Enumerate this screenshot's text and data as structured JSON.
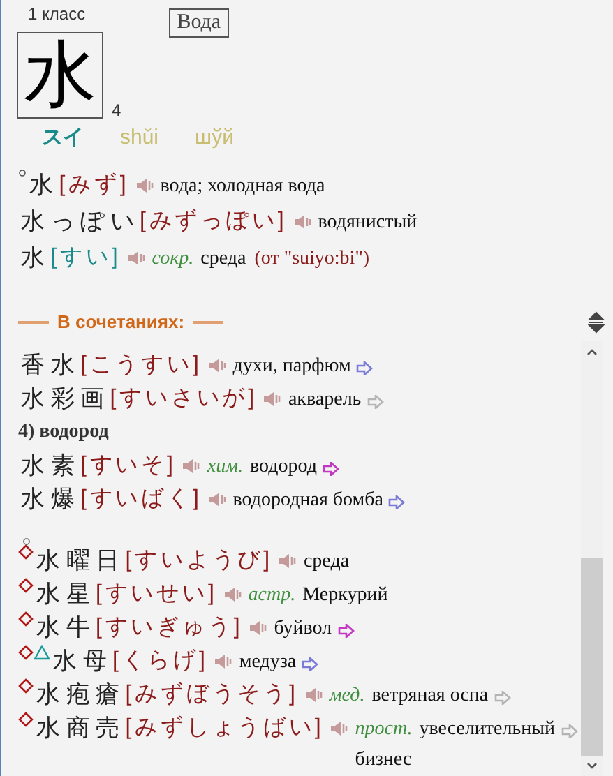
{
  "header": {
    "grade": "1 класс",
    "meaning": "Вода",
    "kanji": "水",
    "strokes": "4",
    "on_reading": "スイ",
    "pinyin": "shǔi",
    "palladius": "шўй"
  },
  "entries": [
    {
      "circle_mark": true,
      "word": "水",
      "reading": {
        "text": "[みず]",
        "color": "#8b1a1a"
      },
      "meaning": "вода; холодная вода"
    },
    {
      "word": "水っぽい",
      "reading": {
        "text": "[みずっぽい]",
        "color": "#8b1a1a"
      },
      "meaning": "водянистый"
    },
    {
      "word": "水",
      "reading": {
        "text": "[すい]",
        "color": "#1a8a8a"
      },
      "label": "сокр.",
      "meaning": "среда",
      "note": "(от \"suiyo:bi\")"
    }
  ],
  "section_title": "В сочетаниях:",
  "compounds": [
    {
      "kind": "entry",
      "word": "香水",
      "reading": {
        "text": "[こうすい]",
        "color": "#8b1a1a"
      },
      "meaning": "духи, парфюм",
      "arrow": {
        "color": "#7a7ad8"
      }
    },
    {
      "kind": "entry",
      "word": "水彩画",
      "reading": {
        "text": "[すいさいが]",
        "color": "#8b1a1a"
      },
      "meaning": "акварель",
      "arrow": {
        "color": "#b4b4b4"
      }
    },
    {
      "kind": "subheading",
      "text": "4) водород"
    },
    {
      "kind": "entry",
      "word": "水素",
      "reading": {
        "text": "[すいそ]",
        "color": "#8b1a1a"
      },
      "label": "хим.",
      "meaning": "водород",
      "arrow": {
        "color": "#c238c2"
      }
    },
    {
      "kind": "entry",
      "word": "水爆",
      "reading": {
        "text": "[すいばく]",
        "color": "#8b1a1a"
      },
      "meaning": "водородная бомба",
      "arrow": {
        "color": "#7a7ad8"
      }
    },
    {
      "kind": "gap"
    },
    {
      "kind": "entry",
      "circle_mark": true,
      "diamond_mark": true,
      "word": "水曜日",
      "reading": {
        "text": "[すいようび]",
        "color": "#8b1a1a"
      },
      "meaning": "среда"
    },
    {
      "kind": "entry",
      "diamond_mark": true,
      "word": "水星",
      "reading": {
        "text": "[すいせい]",
        "color": "#8b1a1a"
      },
      "label": "астр.",
      "meaning": "Меркурий"
    },
    {
      "kind": "entry",
      "diamond_mark": true,
      "word": "水牛",
      "reading": {
        "text": "[すいぎゅう]",
        "color": "#8b1a1a"
      },
      "meaning": "буйвол",
      "arrow": {
        "color": "#c238c2"
      }
    },
    {
      "kind": "entry",
      "diamond_mark": true,
      "triangle_mark": true,
      "word": "水母",
      "reading": {
        "text": "[くらげ]",
        "color": "#8b1a1a"
      },
      "meaning": "медуза",
      "arrow": {
        "color": "#7a7ad8"
      }
    },
    {
      "kind": "entry",
      "diamond_mark": true,
      "word": "水疱瘡",
      "reading": {
        "text": "[みずぼうそう]",
        "color": "#8b1a1a"
      },
      "label": "мед.",
      "meaning": "ветряная оспа",
      "arrow": {
        "color": "#b4b4b4"
      }
    },
    {
      "kind": "entry",
      "diamond_mark": true,
      "word": "水商売",
      "reading": {
        "text": "[みずしょうばい]",
        "color": "#8b1a1a"
      },
      "label": "прост.",
      "meaning": "увеселительный бизнес",
      "arrow": {
        "color": "#b4b4b4"
      }
    }
  ]
}
